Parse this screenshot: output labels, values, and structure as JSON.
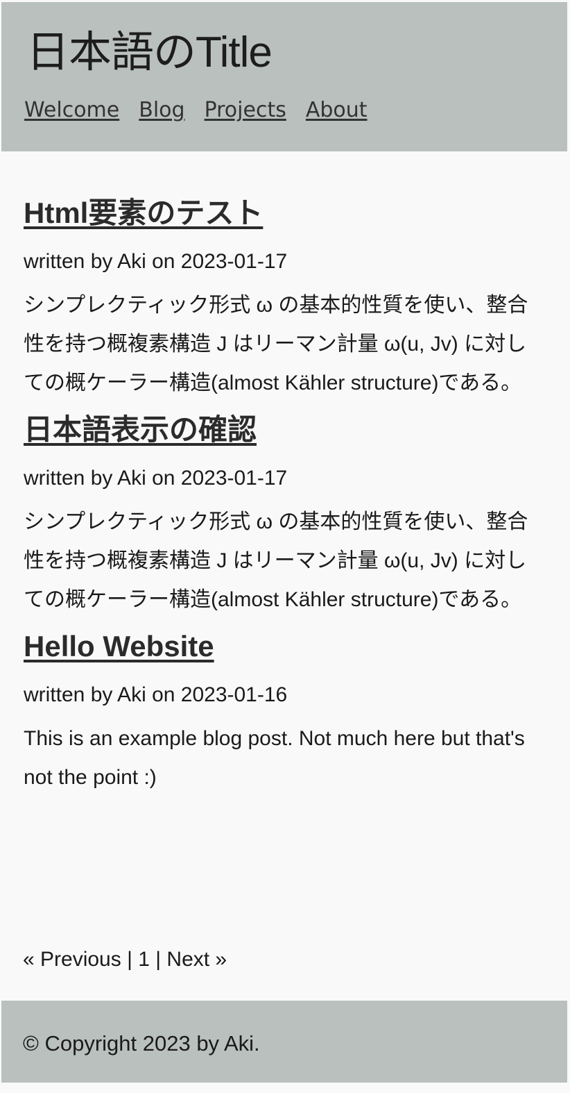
{
  "site": {
    "title": "日本語のTitle"
  },
  "nav": {
    "items": [
      {
        "label": "Welcome"
      },
      {
        "label": "Blog"
      },
      {
        "label": "Projects"
      },
      {
        "label": "About"
      }
    ]
  },
  "posts": [
    {
      "title": "Html要素のテスト",
      "meta": "written by Aki on 2023-01-17",
      "body": "シンプレクティック形式 ω の基本的性質を使い、整合性を持つ概複素構造 J はリーマン計量 ω(u, Jv) に対しての概ケーラー構造(almost Kähler structure)である。"
    },
    {
      "title": "日本語表示の確認",
      "meta": "written by Aki on 2023-01-17",
      "body": "シンプレクティック形式 ω の基本的性質を使い、整合性を持つ概複素構造 J はリーマン計量 ω(u, Jv) に対しての概ケーラー構造(almost Kähler structure)である。"
    },
    {
      "title": "Hello Website",
      "meta": "written by Aki on 2023-01-16",
      "body": "This is an example blog post. Not much here but that's not the point :)"
    }
  ],
  "pagination": {
    "previous": "« Previous",
    "separator": "|",
    "current": "1",
    "next": "Next »"
  },
  "footer": {
    "copyright": "© Copyright 2023 by Aki."
  }
}
